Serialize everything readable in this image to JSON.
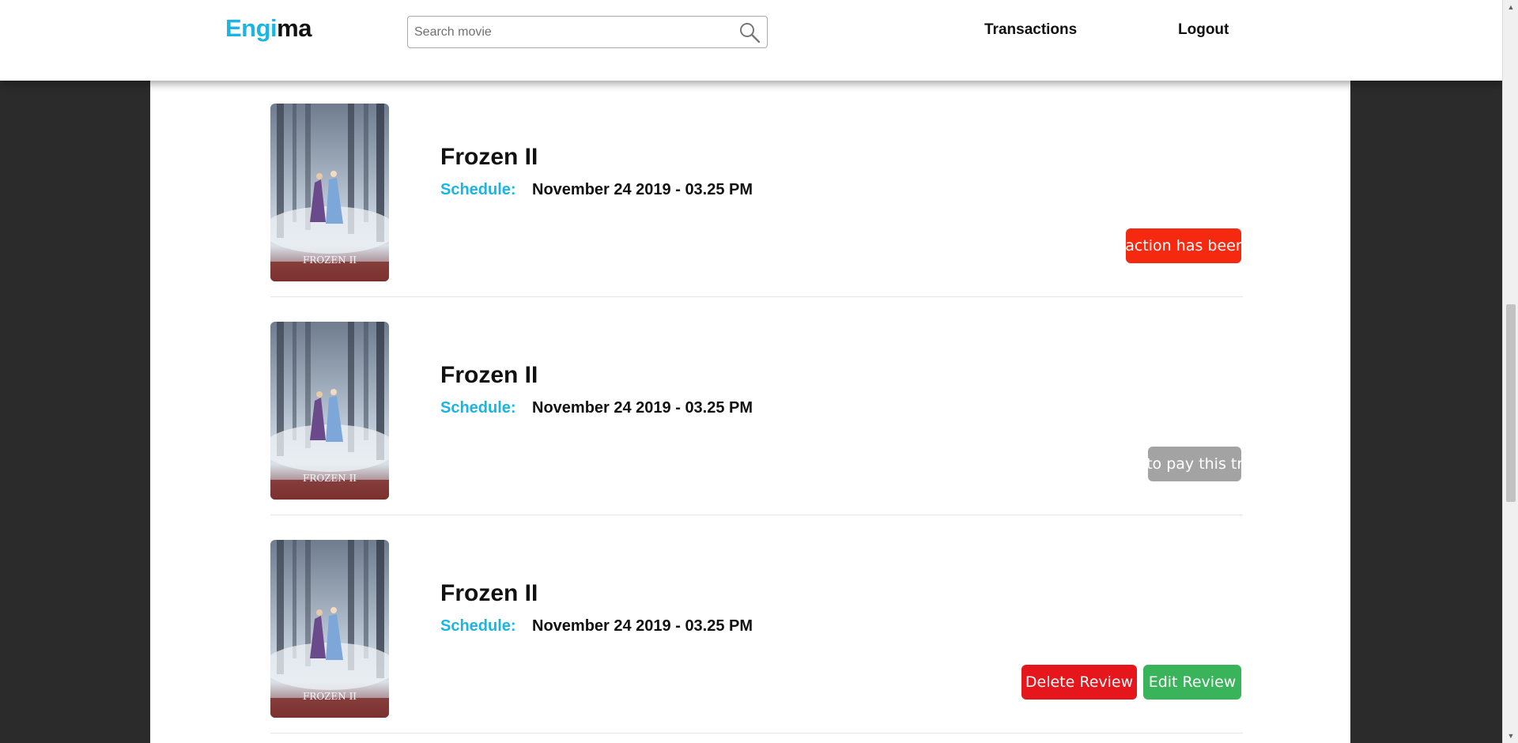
{
  "header": {
    "logo_part1": "Engi",
    "logo_part2": "ma",
    "search_placeholder": "Search movie",
    "nav_transactions": "Transactions",
    "nav_logout": "Logout"
  },
  "transactions": [
    {
      "title": "Frozen II",
      "schedule_label": "Schedule:",
      "schedule_value": "November 24 2019 - 03.25 PM",
      "status": "Your transaction has been canceled",
      "status_color": "#f4290f"
    },
    {
      "title": "Frozen II",
      "schedule_label": "Schedule:",
      "schedule_value": "November 24 2019 - 03.25 PM",
      "status": "You need to pay this transaction",
      "status_color": "#a3a3a3"
    },
    {
      "title": "Frozen II",
      "schedule_label": "Schedule:",
      "schedule_value": "November 24 2019 - 03.25 PM",
      "delete_review_label": "Delete Review",
      "delete_review_color": "#e5161c",
      "edit_review_label": "Edit Review",
      "edit_review_color": "#39b45a"
    }
  ],
  "poster_caption": "FROZEN II",
  "icons": {
    "search": "search-icon",
    "scroll_up": "scroll-up-icon",
    "scroll_down": "scroll-down-icon"
  }
}
